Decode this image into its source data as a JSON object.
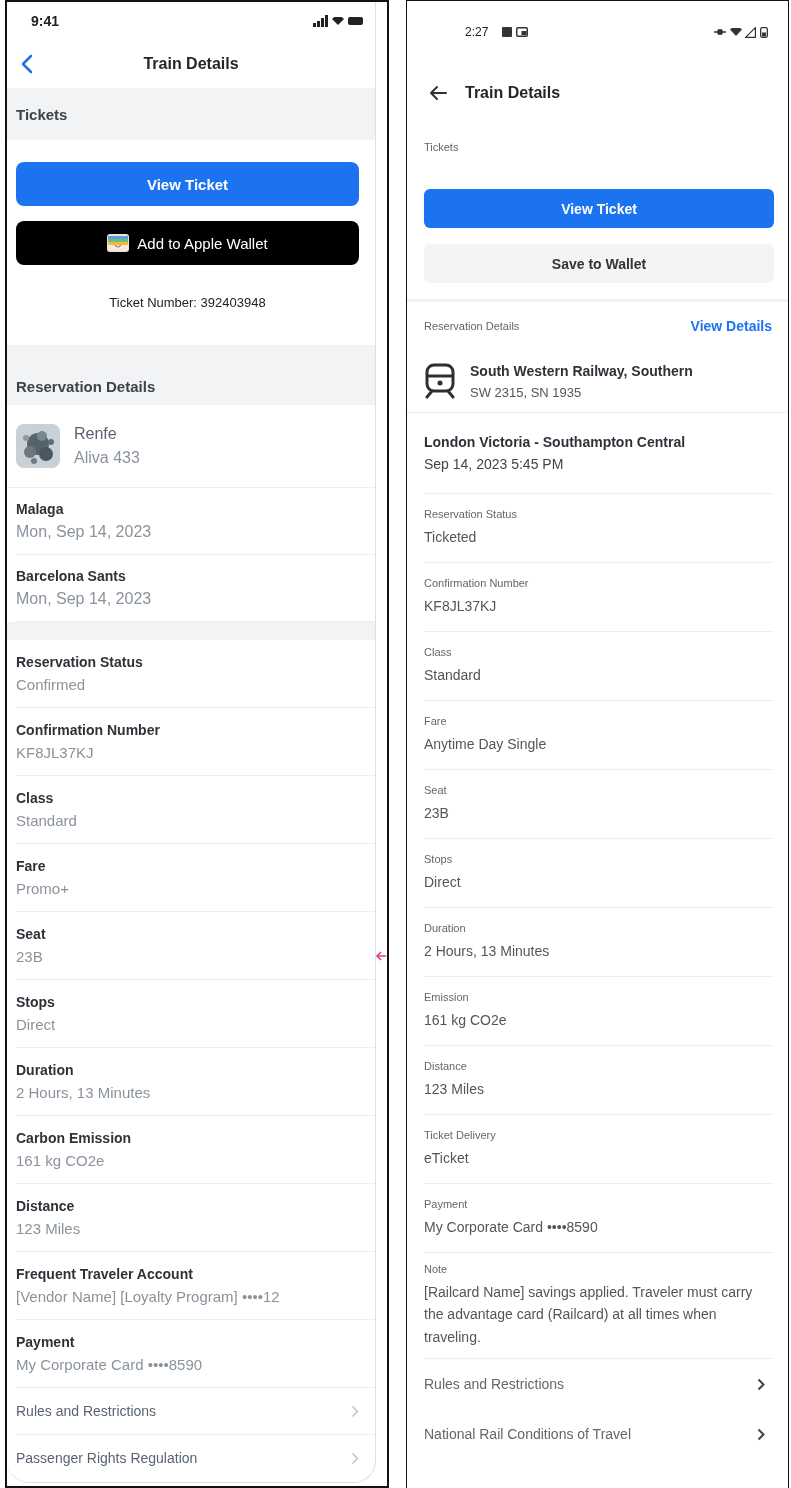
{
  "phones": [
    {
      "kind": "ios",
      "status_time": "9:41",
      "title": "Train Details",
      "tickets": {
        "heading": "Tickets",
        "buttons": [
          {
            "kind": "primary",
            "label": "View Ticket"
          },
          {
            "kind": "wallet",
            "label": "Add to Apple Wallet"
          }
        ],
        "ticket_number": "Ticket Number: 392403948"
      },
      "reservation": {
        "heading": "Reservation Details",
        "carrier": {
          "kind": "picture",
          "name": "Renfe",
          "number": "Aliva 433"
        },
        "legs": [
          {
            "station": "Malaga",
            "date": "Mon, Sep 14, 2023"
          },
          {
            "station": "Barcelona Sants",
            "date": "Mon, Sep 14, 2023"
          }
        ],
        "details": [
          {
            "label": "Reservation Status",
            "value": "Confirmed"
          },
          {
            "label": "Confirmation Number",
            "value": "KF8JL37KJ"
          },
          {
            "label": "Class",
            "value": "Standard"
          },
          {
            "label": "Fare",
            "value": "Promo+"
          },
          {
            "label": "Seat",
            "value": "23B"
          },
          {
            "label": "Stops",
            "value": "Direct"
          },
          {
            "label": "Duration",
            "value": "2 Hours, 13 Minutes"
          },
          {
            "label": "Carbon Emission",
            "value": "161 kg CO2e"
          },
          {
            "label": "Distance",
            "value": "123 Miles"
          },
          {
            "label": "Frequent Traveler Account",
            "value": "[Vendor Name] [Loyalty Program] ••••12"
          },
          {
            "label": "Payment",
            "value": "My Corporate Card ••••8590"
          }
        ],
        "links": [
          "Rules and Restrictions",
          "Passenger Rights Regulation"
        ]
      }
    },
    {
      "kind": "android",
      "status_time": "2:27",
      "title": "Train Details",
      "tickets": {
        "heading": "Tickets",
        "buttons": [
          {
            "kind": "primary",
            "label": "View Ticket"
          },
          {
            "kind": "secondary",
            "label": "Save to Wallet"
          }
        ]
      },
      "reservation": {
        "heading": "Reservation Details",
        "action": "View Details",
        "carrier": {
          "kind": "train",
          "name": "South Western Railway, Southern",
          "number": "SW 2315, SN 1935"
        },
        "legs": [
          {
            "station": "London Victoria - Southampton Central",
            "date": "Sep 14, 2023 5:45 PM"
          }
        ],
        "details": [
          {
            "label": "Reservation Status",
            "value": "Ticketed"
          },
          {
            "label": "Confirmation Number",
            "value": "KF8JL37KJ"
          },
          {
            "label": "Class",
            "value": "Standard"
          },
          {
            "label": "Fare",
            "value": "Anytime Day Single"
          },
          {
            "label": "Seat",
            "value": "23B"
          },
          {
            "label": "Stops",
            "value": "Direct"
          },
          {
            "label": "Duration",
            "value": "2 Hours, 13 Minutes"
          },
          {
            "label": "Emission",
            "value": "161 kg CO2e"
          },
          {
            "label": "Distance",
            "value": "123 Miles"
          },
          {
            "label": "Ticket Delivery",
            "value": "eTicket"
          },
          {
            "label": "Payment",
            "value": "My Corporate Card ••••8590"
          },
          {
            "label": "Note",
            "value": "[Railcard Name] savings applied. Traveler must carry the advantage card (Railcard) at all times when traveling."
          }
        ],
        "links": [
          "Rules and Restrictions",
          "National Rail Conditions of Travel"
        ]
      }
    }
  ]
}
